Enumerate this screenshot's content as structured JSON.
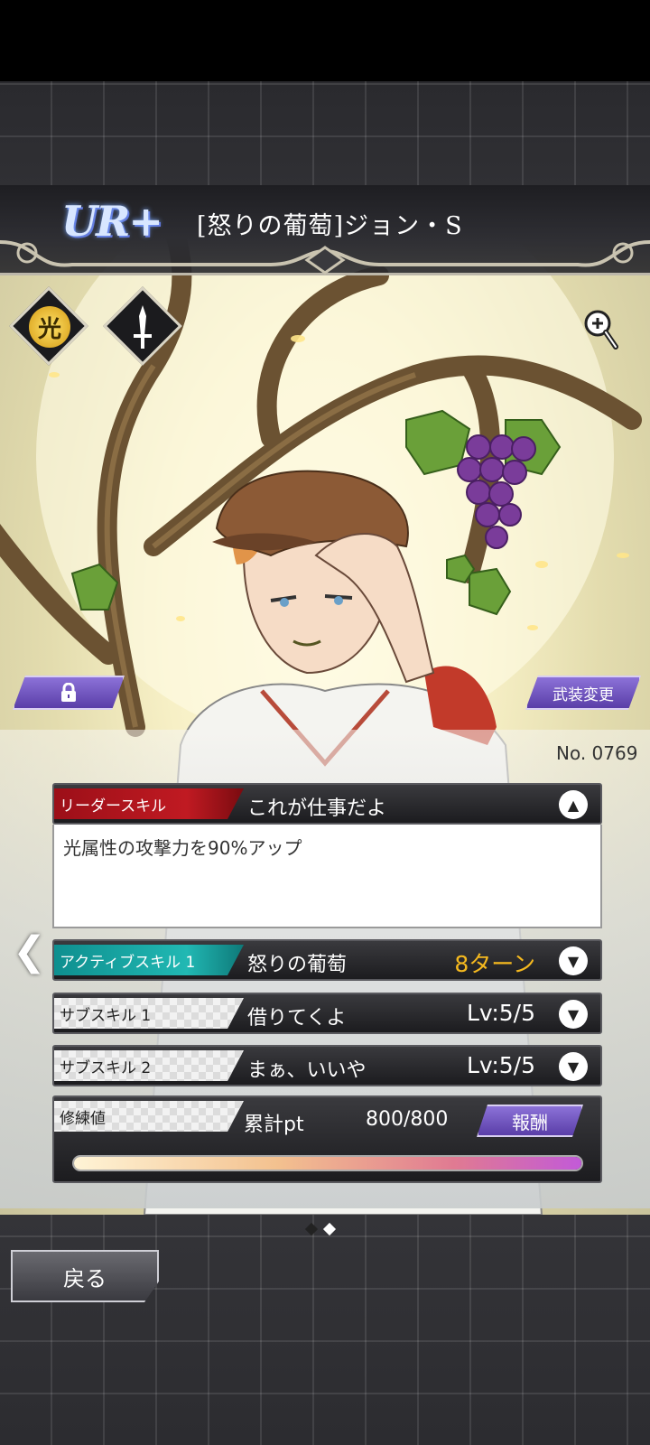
{
  "header": {
    "rarity": "UR+",
    "card_title": "[怒りの葡萄]ジョン・S"
  },
  "attributes": {
    "element_glyph": "光",
    "element_icon": "light-attribute-icon",
    "weapon_icon": "sword-icon"
  },
  "buttons": {
    "lock_icon": "lock-icon",
    "equip_change": "武装変更",
    "reward": "報酬",
    "back": "戻る"
  },
  "card_number": "No. 0769",
  "leader_skill": {
    "tag": "リーダースキル",
    "name": "これが仕事だよ",
    "description": "光属性の攻撃力を90%アップ",
    "toggle": "▲"
  },
  "active_skill": {
    "tag": "アクティブスキル 1",
    "name": "怒りの葡萄",
    "value": "8ターン",
    "toggle": "▼"
  },
  "sub_skills": [
    {
      "tag": "サブスキル 1",
      "name": "借りてくよ",
      "value": "Lv:5/5",
      "toggle": "▼"
    },
    {
      "tag": "サブスキル 2",
      "name": "まぁ、いいや",
      "value": "Lv:5/5",
      "toggle": "▼"
    }
  ],
  "training": {
    "tag": "修練値",
    "pt_label": "累計pt",
    "pt_value": "800/800",
    "progress": 1.0
  },
  "pagination": {
    "current": 1,
    "total": 2
  },
  "colors": {
    "accent_purple": "#6a4fc0",
    "skill_gold": "#f5b91f",
    "leader_red": "#c01a22",
    "active_teal": "#21b8b3"
  }
}
